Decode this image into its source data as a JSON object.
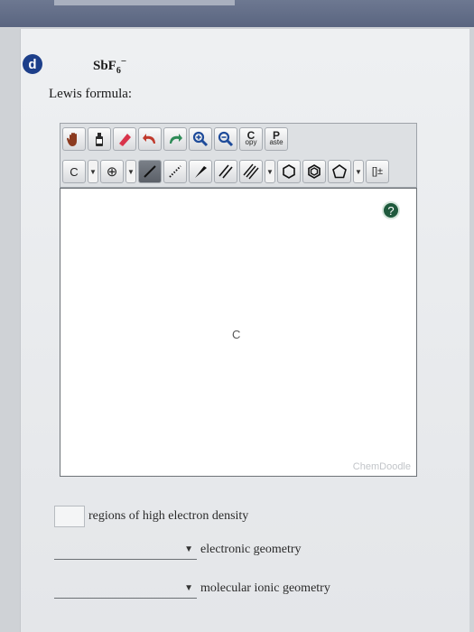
{
  "question": {
    "badge": "d",
    "formula_main": "SbF",
    "formula_sub": "6",
    "formula_sup": "−",
    "lewis_label": "Lewis formula:"
  },
  "toolbar": {
    "copy_label_big": "C",
    "copy_label_small": "opy",
    "paste_label_big": "P",
    "paste_label_small": "aste",
    "element_label": "C",
    "bracket_label": "[]±"
  },
  "canvas": {
    "atom_label": "C",
    "watermark": "ChemDoodle"
  },
  "fields": {
    "regions_label": "regions of high electron density",
    "regions_value": "",
    "electronic_value": "",
    "electronic_label": "electronic geometry",
    "molecular_value": "",
    "molecular_label": "molecular ionic geometry"
  },
  "colors": {
    "badge": "#1d3f8a",
    "topbar": "#5a6580",
    "help_icon": "#1f5a3d"
  }
}
